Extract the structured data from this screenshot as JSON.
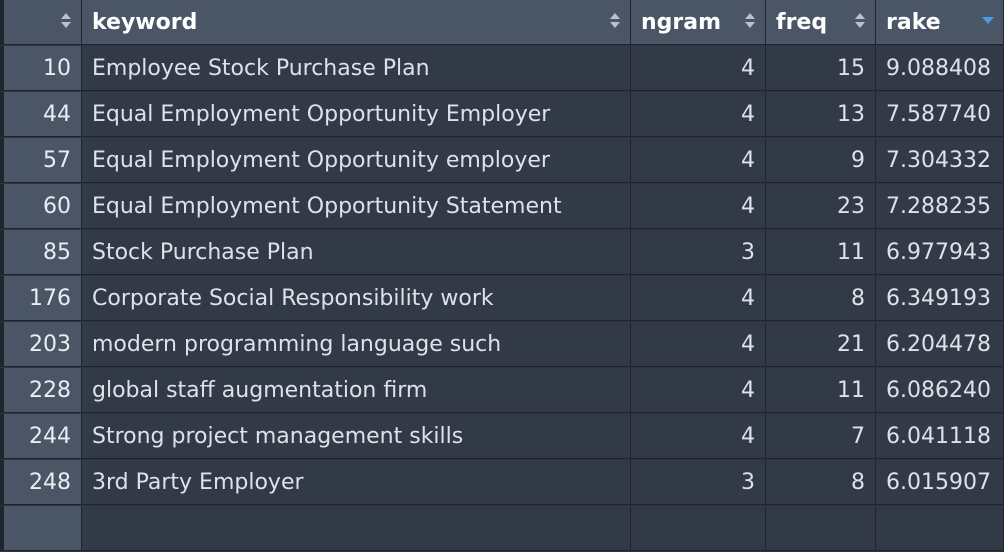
{
  "table": {
    "columns": [
      {
        "label": "",
        "sort": "none"
      },
      {
        "label": "keyword",
        "sort": "none"
      },
      {
        "label": "ngram",
        "sort": "none"
      },
      {
        "label": "freq",
        "sort": "none"
      },
      {
        "label": "rake",
        "sort": "desc"
      }
    ],
    "rows": [
      {
        "id": "10",
        "keyword": "Employee Stock Purchase Plan",
        "ngram": "4",
        "freq": "15",
        "rake": "9.088408"
      },
      {
        "id": "44",
        "keyword": "Equal Employment Opportunity Employer",
        "ngram": "4",
        "freq": "13",
        "rake": "7.587740"
      },
      {
        "id": "57",
        "keyword": "Equal Employment Opportunity employer",
        "ngram": "4",
        "freq": "9",
        "rake": "7.304332"
      },
      {
        "id": "60",
        "keyword": "Equal Employment Opportunity Statement",
        "ngram": "4",
        "freq": "23",
        "rake": "7.288235"
      },
      {
        "id": "85",
        "keyword": "Stock Purchase Plan",
        "ngram": "3",
        "freq": "11",
        "rake": "6.977943"
      },
      {
        "id": "176",
        "keyword": "Corporate Social Responsibility work",
        "ngram": "4",
        "freq": "8",
        "rake": "6.349193"
      },
      {
        "id": "203",
        "keyword": "modern programming language such",
        "ngram": "4",
        "freq": "21",
        "rake": "6.204478"
      },
      {
        "id": "228",
        "keyword": "global staff augmentation firm",
        "ngram": "4",
        "freq": "11",
        "rake": "6.086240"
      },
      {
        "id": "244",
        "keyword": "Strong project management skills",
        "ngram": "4",
        "freq": "7",
        "rake": "6.041118"
      },
      {
        "id": "248",
        "keyword": "3rd Party Employer",
        "ngram": "3",
        "freq": "8",
        "rake": "6.015907"
      }
    ]
  }
}
